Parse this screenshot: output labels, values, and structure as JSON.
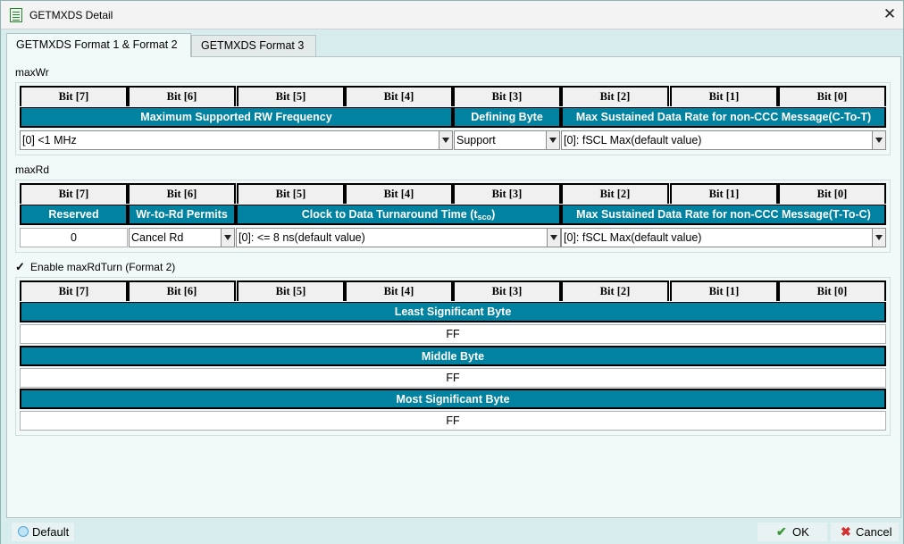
{
  "window": {
    "title": "GETMXDS Detail",
    "close_glyph": "✕"
  },
  "tabs": [
    {
      "label": "GETMXDS Format 1 & Format 2",
      "active": true
    },
    {
      "label": "GETMXDS Format 3",
      "active": false
    }
  ],
  "bit_labels": [
    "Bit [7]",
    "Bit [6]",
    "Bit [5]",
    "Bit [4]",
    "Bit [3]",
    "Bit [2]",
    "Bit [1]",
    "Bit [0]"
  ],
  "maxWr": {
    "label": "maxWr",
    "headers": {
      "max_rw_freq": "Maximum Supported RW Frequency",
      "defining_byte": "Defining Byte",
      "max_rate_ctot": "Max Sustained Data Rate for non-CCC Message(C-To-T)"
    },
    "values": {
      "max_rw_freq": "[0] <1 MHz",
      "defining_byte": "Support",
      "max_rate_ctot": "[0]: fSCL Max(default value)"
    }
  },
  "maxRd": {
    "label": "maxRd",
    "headers": {
      "reserved": "Reserved",
      "wr_to_rd": "Wr-to-Rd Permits",
      "turnaround_main": "Clock to Data Turnaround Time (t",
      "turnaround_sub": "sco",
      "turnaround_end": ")",
      "max_rate_ttoc": "Max Sustained Data Rate for non-CCC Message(T-To-C)"
    },
    "values": {
      "reserved": "0",
      "wr_to_rd": "Cancel Rd",
      "turnaround": "[0]: <= 8 ns(default value)",
      "max_rate_ttoc": "[0]: fSCL Max(default value)"
    }
  },
  "maxRdTurn": {
    "checkbox_label": "Enable maxRdTurn (Format 2)",
    "checked": true,
    "check_glyph": "✓",
    "bytes": [
      {
        "label": "Least Significant Byte",
        "value": "FF"
      },
      {
        "label": "Middle Byte",
        "value": "FF"
      },
      {
        "label": "Most Significant Byte",
        "value": "FF"
      }
    ]
  },
  "footer": {
    "default_label": "Default",
    "ok_label": "OK",
    "ok_glyph": "✔",
    "cancel_label": "Cancel",
    "cancel_glyph": "✖"
  },
  "colors": {
    "header_bg": "#0082a0",
    "window_bg": "#d7eded",
    "panel_bg": "#f2f9f9",
    "ok_icon": "#3a9a3a",
    "cancel_icon": "#d32f2f"
  },
  "icons": {
    "app": "document-icon",
    "close": "close-icon",
    "check": "checkmark-icon",
    "default": "circle-icon",
    "ok": "ok-check-icon",
    "cancel": "cancel-x-icon"
  }
}
